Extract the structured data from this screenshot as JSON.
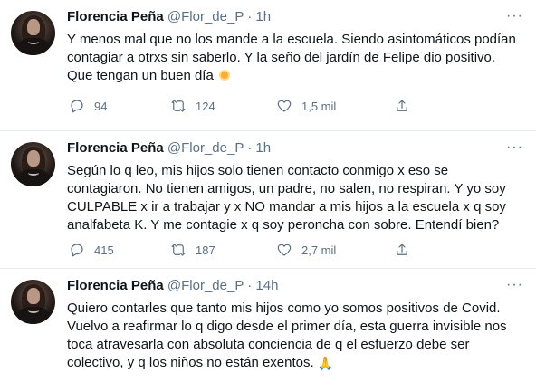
{
  "tweets": [
    {
      "name": "Florencia Peña",
      "handle": "@Flor_de_P",
      "separator": "·",
      "time": "1h",
      "text": "Y menos mal que no los mande a la escuela. Siendo asintomáticos podían contagiar a otrxs sin saberlo. Y la seño del jardín de Felipe dio positivo. Que tengan un buen día",
      "emoji": "sun-emoji",
      "replies": "94",
      "retweets": "124",
      "likes": "1,5 mil"
    },
    {
      "name": "Florencia Peña",
      "handle": "@Flor_de_P",
      "separator": "·",
      "time": "1h",
      "text": "Según lo q leo, mis hijos solo tienen contacto conmigo x eso se contagiaron. No tienen amigos, un padre, no salen, no respiran. Y yo soy CULPABLE x ir a trabajar y x NO mandar a mis hijos a la escuela x q soy analfabeta K. Y me contagie x q soy peroncha con sobre. Entendí bien?",
      "replies": "415",
      "retweets": "187",
      "likes": "2,7 mil"
    },
    {
      "name": "Florencia Peña",
      "handle": "@Flor_de_P",
      "separator": "·",
      "time": "14h",
      "text": "Quiero contarles que tanto mis hijos como yo somos positivos de Covid. Vuelvo a reafirmar lo q digo desde el primer día, esta guerra invisible nos toca atravesarla con absoluta conciencia de q el esfuerzo debe ser colectivo, y q los niños no están exentos.",
      "emoji": "folded-hands-emoji"
    }
  ],
  "icons": {
    "more": "more-icon",
    "reply": "reply-icon",
    "retweet": "retweet-icon",
    "like": "like-icon",
    "share": "share-icon"
  },
  "colors": {
    "text": "#0f1419",
    "secondary": "#5b7083",
    "divider": "#e6ecf0"
  }
}
